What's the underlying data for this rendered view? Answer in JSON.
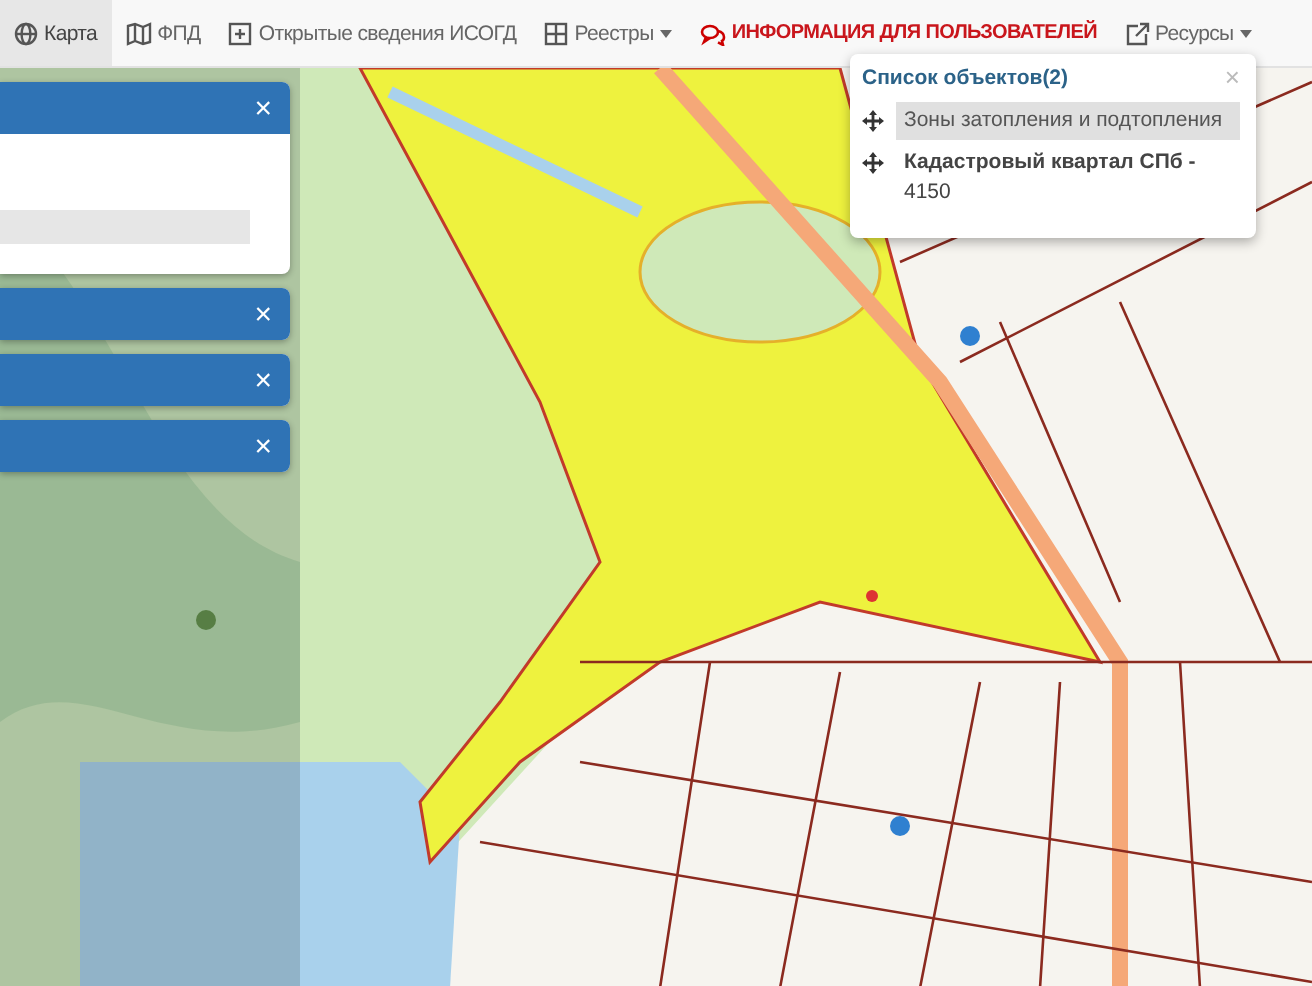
{
  "navbar": {
    "items": [
      {
        "kind": "globe",
        "label": "Карта",
        "selected": true,
        "dropdown": false,
        "highlight": false
      },
      {
        "kind": "map",
        "label": "ФПД",
        "selected": false,
        "dropdown": false,
        "highlight": false
      },
      {
        "kind": "plus",
        "label": "Открытые сведения ИСОГД",
        "selected": false,
        "dropdown": false,
        "highlight": false
      },
      {
        "kind": "grid",
        "label": "Реестры",
        "selected": false,
        "dropdown": true,
        "highlight": false
      },
      {
        "kind": "chat",
        "label": "ИНФОРМАЦИЯ ДЛЯ ПОЛЬЗОВАТЕЛЕЙ",
        "selected": false,
        "dropdown": false,
        "highlight": true
      },
      {
        "kind": "external",
        "label": "Ресурсы",
        "selected": false,
        "dropdown": true,
        "highlight": false
      }
    ]
  },
  "side_panels": [
    {
      "expanded": true,
      "close": "×"
    },
    {
      "expanded": false,
      "close": "×"
    },
    {
      "expanded": false,
      "close": "×"
    },
    {
      "expanded": false,
      "close": "×"
    }
  ],
  "popup": {
    "title": "Список объектов(2)",
    "close": "×",
    "items": [
      {
        "text": "Зоны затопления и подтопления",
        "selected": true
      },
      {
        "text": "**Кадастровый квартал СПб -** 4150",
        "selected": false
      }
    ]
  }
}
